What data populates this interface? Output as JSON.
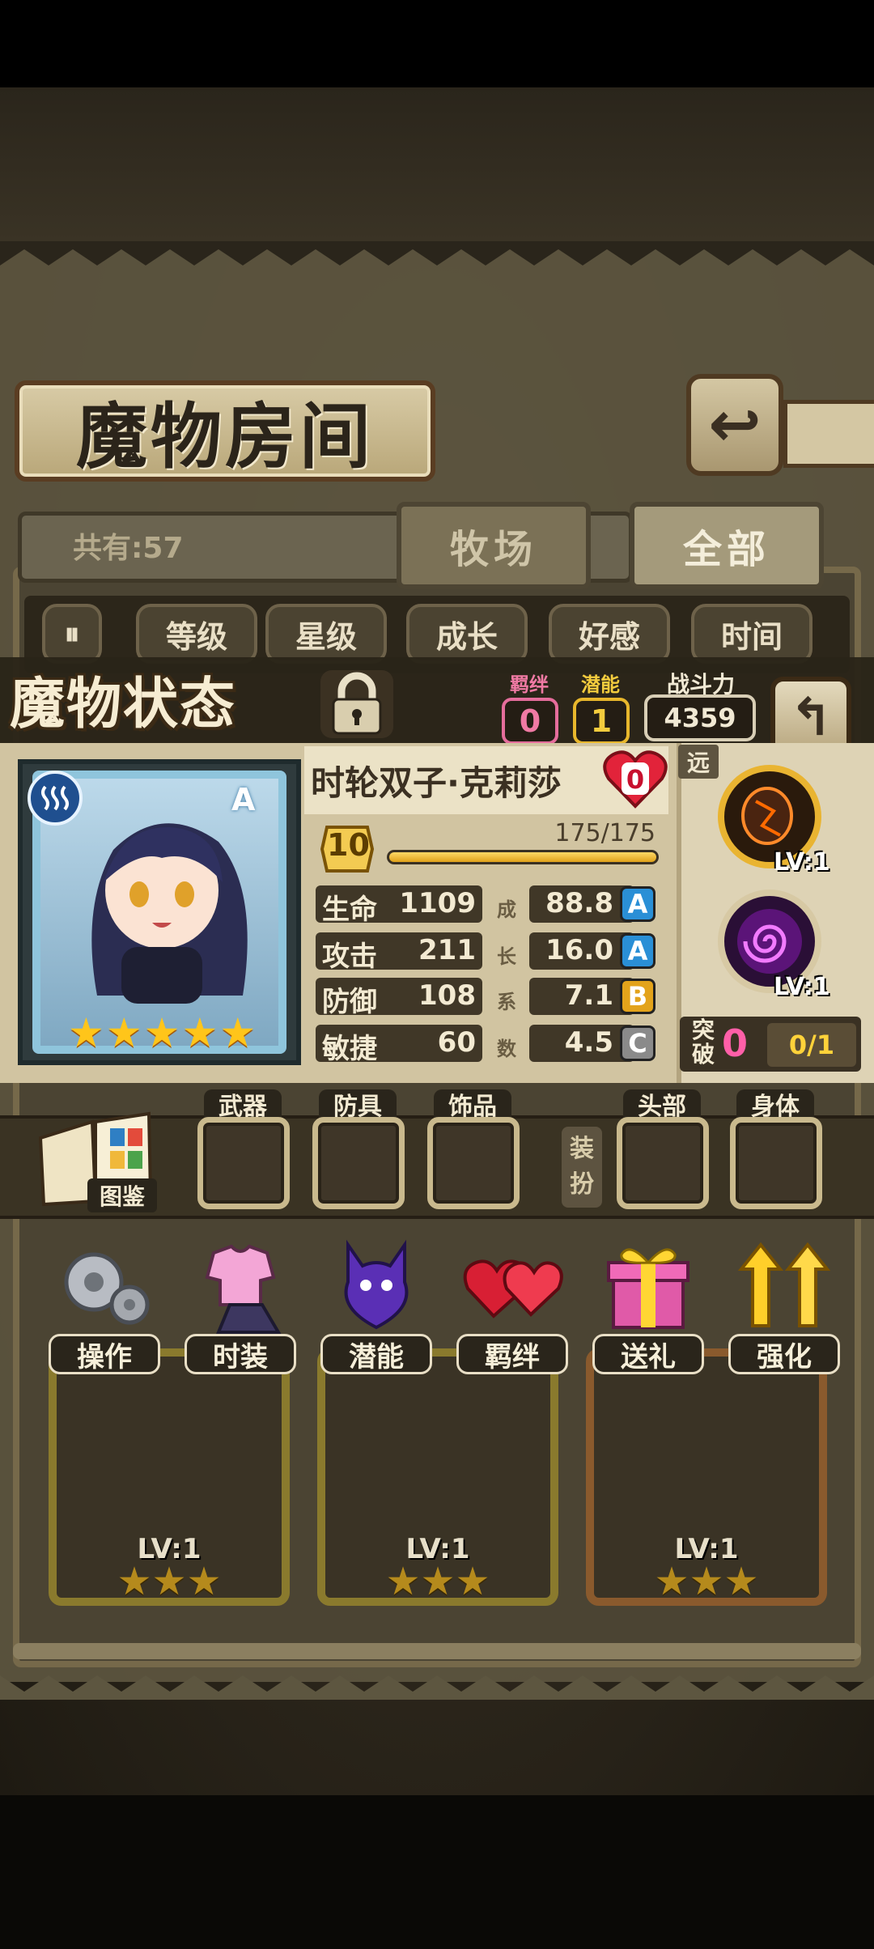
{
  "room": {
    "title": "魔物房间",
    "count_text": "共有:57",
    "tabs": [
      {
        "label": "牧场"
      },
      {
        "label": "全部"
      }
    ],
    "sort_buttons": [
      "等级",
      "星级",
      "成长",
      "好感",
      "时间"
    ]
  },
  "status": {
    "title": "魔物状态",
    "bond_label": "羁绊",
    "bond_value": "0",
    "potential_label": "潜能",
    "potential_value": "1",
    "power_label": "战斗力",
    "power_value": "4359"
  },
  "monster": {
    "name": "时轮双子·克莉莎",
    "bond_heart_value": "0",
    "portrait_grade": "A",
    "stars": 5,
    "level": "10",
    "exp_text": "175/175",
    "exp_fraction": 1.0,
    "stats": [
      {
        "name": "生命",
        "value": "1109",
        "growth": "88.8",
        "grade": "A"
      },
      {
        "name": "攻击",
        "value": "211",
        "growth": "16.0",
        "grade": "A"
      },
      {
        "name": "防御",
        "value": "108",
        "growth": "7.1",
        "grade": "B"
      },
      {
        "name": "敏捷",
        "value": "60",
        "growth": "4.5",
        "grade": "C"
      }
    ],
    "growth_label_chars": [
      "成",
      "长",
      "系",
      "数"
    ],
    "range_tag": "远",
    "skills": [
      {
        "icon": "meteor-skill-icon",
        "level": "LV:1"
      },
      {
        "icon": "vortex-skill-icon",
        "level": "LV:1"
      }
    ],
    "breakthrough_label": "突破",
    "breakthrough_count": "0",
    "breakthrough_progress": "0/1"
  },
  "equipment": {
    "book_label": "图鉴",
    "slots": [
      "武器",
      "防具",
      "饰品",
      "头部",
      "身体"
    ],
    "dress_up_label": "装扮"
  },
  "actions": [
    "操作",
    "时装",
    "潜能",
    "羁绊",
    "送礼",
    "强化"
  ],
  "cards": [
    {
      "level": "LV:1",
      "stars": 3
    },
    {
      "level": "LV:1",
      "stars": 3
    },
    {
      "level": "LV:1",
      "stars": 3
    }
  ],
  "colors": {
    "grade_A": "#2a8fd6",
    "grade_B": "#e3a31b",
    "grade_C": "#8a8a8a",
    "bond_pink": "#e56d9c",
    "potential_gold": "#e8b72c",
    "star_gold": "#ffc51a"
  }
}
